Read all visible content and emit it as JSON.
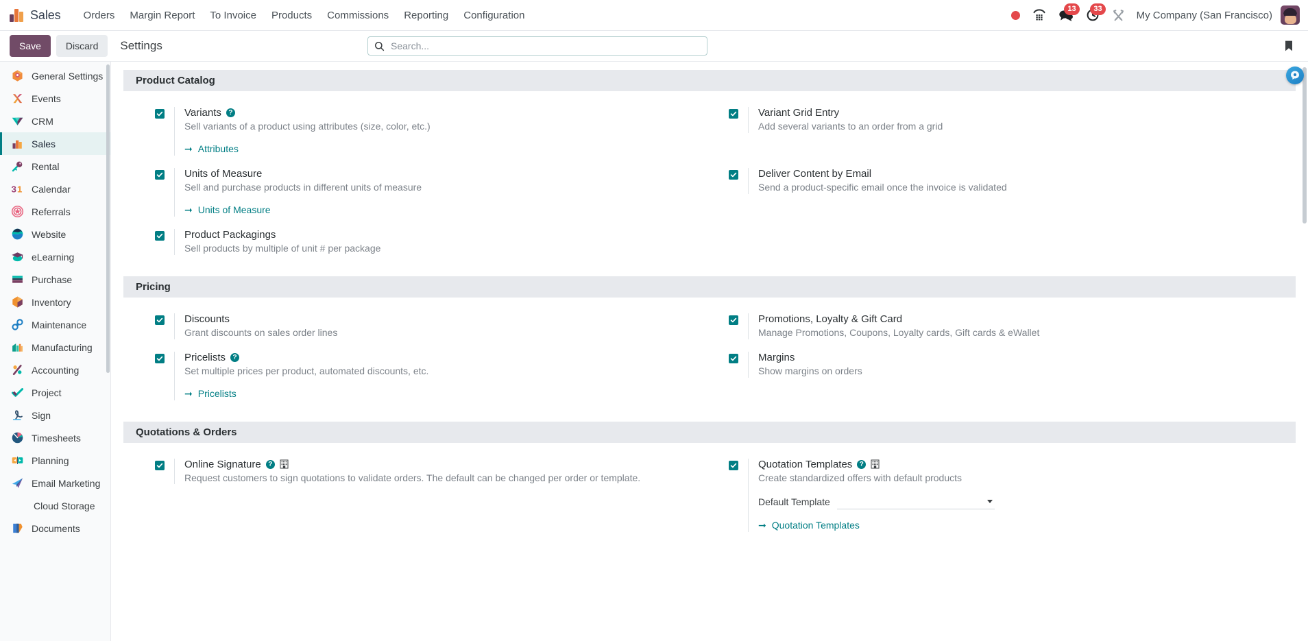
{
  "navbar": {
    "app_name": "Sales",
    "menu": [
      {
        "label": "Orders"
      },
      {
        "label": "Margin Report"
      },
      {
        "label": "To Invoice"
      },
      {
        "label": "Products"
      },
      {
        "label": "Commissions"
      },
      {
        "label": "Reporting"
      },
      {
        "label": "Configuration"
      }
    ],
    "systray": {
      "recording_icon": "record-dot-icon",
      "dialpad_icon": "voip-dialpad-icon",
      "messages_icon": "messages-icon",
      "messages_count": "13",
      "activities_icon": "activities-clock-icon",
      "activities_count": "33",
      "debug_icon": "developer-tools-icon",
      "company": "My Company (San Francisco)",
      "avatar": "user-avatar"
    }
  },
  "control_panel": {
    "save_label": "Save",
    "discard_label": "Discard",
    "title": "Settings",
    "search_placeholder": "Search...",
    "search_value": "",
    "search_icon": "search-icon",
    "bookmark_icon": "bookmark-icon"
  },
  "sidebar": {
    "items": [
      {
        "label": "General Settings",
        "icon": "general-settings-icon",
        "active": false
      },
      {
        "label": "Events",
        "icon": "events-icon",
        "active": false
      },
      {
        "label": "CRM",
        "icon": "crm-icon",
        "active": false
      },
      {
        "label": "Sales",
        "icon": "sales-icon",
        "active": true
      },
      {
        "label": "Rental",
        "icon": "rental-icon",
        "active": false
      },
      {
        "label": "Calendar",
        "icon": "calendar-icon",
        "active": false
      },
      {
        "label": "Referrals",
        "icon": "referrals-icon",
        "active": false
      },
      {
        "label": "Website",
        "icon": "website-icon",
        "active": false
      },
      {
        "label": "eLearning",
        "icon": "elearning-icon",
        "active": false
      },
      {
        "label": "Purchase",
        "icon": "purchase-icon",
        "active": false
      },
      {
        "label": "Inventory",
        "icon": "inventory-icon",
        "active": false
      },
      {
        "label": "Maintenance",
        "icon": "maintenance-icon",
        "active": false
      },
      {
        "label": "Manufacturing",
        "icon": "manufacturing-icon",
        "active": false
      },
      {
        "label": "Accounting",
        "icon": "accounting-icon",
        "active": false
      },
      {
        "label": "Project",
        "icon": "project-icon",
        "active": false
      },
      {
        "label": "Sign",
        "icon": "sign-icon",
        "active": false
      },
      {
        "label": "Timesheets",
        "icon": "timesheets-icon",
        "active": false
      },
      {
        "label": "Planning",
        "icon": "planning-icon",
        "active": false
      },
      {
        "label": "Email Marketing",
        "icon": "email-marketing-icon",
        "active": false
      },
      {
        "label": "Cloud Storage",
        "icon": "",
        "active": false
      },
      {
        "label": "Documents",
        "icon": "documents-icon",
        "active": false
      }
    ]
  },
  "sections": [
    {
      "title": "Product Catalog",
      "settings": [
        {
          "title": "Variants",
          "desc": "Sell variants of a product using attributes (size, color, etc.)",
          "checked": true,
          "help": true,
          "company": false,
          "link": "Attributes"
        },
        {
          "title": "Variant Grid Entry",
          "desc": "Add several variants to an order from a grid",
          "checked": true,
          "help": false,
          "company": false,
          "link": ""
        },
        {
          "title": "Units of Measure",
          "desc": "Sell and purchase products in different units of measure",
          "checked": true,
          "help": false,
          "company": false,
          "link": "Units of Measure"
        },
        {
          "title": "Deliver Content by Email",
          "desc": "Send a product-specific email once the invoice is validated",
          "checked": true,
          "help": false,
          "company": false,
          "link": ""
        },
        {
          "title": "Product Packagings",
          "desc": "Sell products by multiple of unit # per package",
          "checked": true,
          "help": false,
          "company": false,
          "link": ""
        }
      ]
    },
    {
      "title": "Pricing",
      "settings": [
        {
          "title": "Discounts",
          "desc": "Grant discounts on sales order lines",
          "checked": true,
          "help": false,
          "company": false,
          "link": ""
        },
        {
          "title": "Promotions, Loyalty & Gift Card",
          "desc": "Manage Promotions, Coupons, Loyalty cards, Gift cards & eWallet",
          "checked": true,
          "help": false,
          "company": false,
          "link": ""
        },
        {
          "title": "Pricelists",
          "desc": "Set multiple prices per product, automated discounts, etc.",
          "checked": true,
          "help": true,
          "company": false,
          "link": "Pricelists"
        },
        {
          "title": "Margins",
          "desc": "Show margins on orders",
          "checked": true,
          "help": false,
          "company": false,
          "link": ""
        }
      ]
    },
    {
      "title": "Quotations & Orders",
      "settings": [
        {
          "title": "Online Signature",
          "desc": "Request customers to sign quotations to validate orders. The default can be changed per order or template.",
          "checked": true,
          "help": true,
          "company": true,
          "link": ""
        },
        {
          "title": "Quotation Templates",
          "desc": "Create standardized offers with default products",
          "checked": true,
          "help": true,
          "company": true,
          "link": "Quotation Templates",
          "field": {
            "label": "Default Template",
            "value": ""
          }
        }
      ]
    }
  ],
  "fab": {
    "icon": "odoo-assistant-icon"
  }
}
